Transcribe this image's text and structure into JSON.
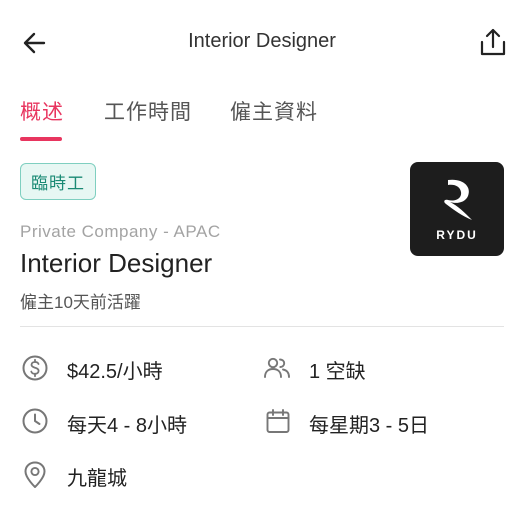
{
  "header": {
    "title": "Interior Designer",
    "back_icon": "back-arrow-icon",
    "share_icon": "share-icon"
  },
  "tabs": [
    {
      "label": "概述",
      "active": true
    },
    {
      "label": "工作時間",
      "active": false
    },
    {
      "label": "僱主資料",
      "active": false
    }
  ],
  "job": {
    "badge": "臨時工",
    "company": "Private Company - APAC",
    "title": "Interior Designer",
    "employer_activity": "僱主10天前活躍",
    "logo_text": "RYDU"
  },
  "details": {
    "salary": "$42.5/小時",
    "vacancies": "1 空缺",
    "hours": "每天4 - 8小時",
    "days": "每星期3 - 5日",
    "location": "九龍城"
  },
  "colors": {
    "accent": "#e8355f",
    "badge_text": "#1a8a74",
    "badge_bg": "#e7f7f3",
    "badge_border": "#7fcfc0"
  }
}
